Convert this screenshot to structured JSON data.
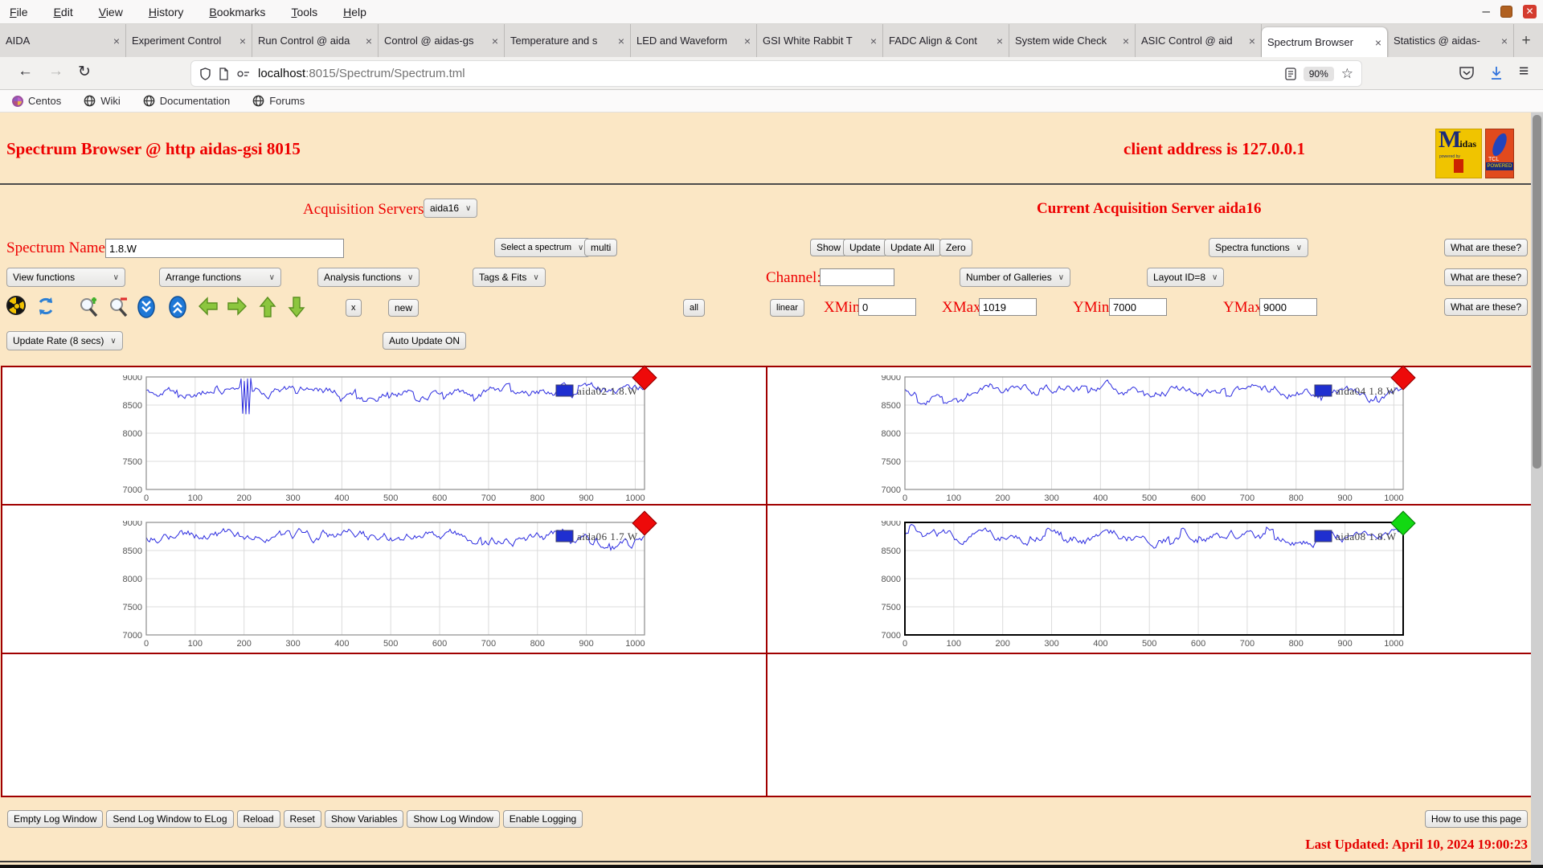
{
  "browser": {
    "menubar": {
      "items": [
        "File",
        "Edit",
        "View",
        "History",
        "Bookmarks",
        "Tools",
        "Help"
      ]
    },
    "tabs": [
      {
        "label": "AIDA",
        "active": false
      },
      {
        "label": "Experiment Control",
        "active": false
      },
      {
        "label": "Run Control @ aida",
        "active": false
      },
      {
        "label": "Control @ aidas-gs",
        "active": false
      },
      {
        "label": "Temperature and s",
        "active": false
      },
      {
        "label": "LED and Waveform",
        "active": false
      },
      {
        "label": "GSI White Rabbit T",
        "active": false
      },
      {
        "label": "FADC Align & Cont",
        "active": false
      },
      {
        "label": "System wide Check",
        "active": false
      },
      {
        "label": "ASIC Control @ aid",
        "active": false
      },
      {
        "label": "Spectrum Browser",
        "active": true
      },
      {
        "label": "Statistics @ aidas-",
        "active": false
      }
    ],
    "new_tab": "+",
    "nav": {
      "back": "←",
      "forward": "→",
      "reload": "↻",
      "url_host": "localhost",
      "url_rest": ":8015/Spectrum/Spectrum.tml",
      "zoom_badge": "90%",
      "star": "☆",
      "menu": "≡"
    },
    "bookmarks": [
      {
        "label": "Centos",
        "icon": "centos-icon"
      },
      {
        "label": "Wiki",
        "icon": "globe-icon"
      },
      {
        "label": "Documentation",
        "icon": "globe-icon"
      },
      {
        "label": "Forums",
        "icon": "globe-icon"
      }
    ]
  },
  "page": {
    "title": "Spectrum Browser @ http aidas-gsi 8015",
    "client_address": "client address is 127.0.0.1",
    "acquisition": {
      "label": "Acquisition Servers",
      "selected": "aida16",
      "current": "Current Acquisition Server aida16"
    },
    "spectrum_row": {
      "name_label": "Spectrum Name:",
      "name_value": "1.8.W",
      "select_spectrum": "Select a spectrum",
      "multi": "multi",
      "show": "Show",
      "update": "Update",
      "update_all": "Update All",
      "zero": "Zero",
      "spectra_functions": "Spectra functions",
      "what": "What are these?"
    },
    "functions_row": {
      "view": "View functions",
      "arrange": "Arrange functions",
      "analysis": "Analysis functions",
      "tags": "Tags & Fits",
      "channel_label": "Channel:",
      "channel_value": "",
      "galleries": "Number of Galleries",
      "layout": "Layout ID=8",
      "what": "What are these?"
    },
    "toolbar_row": {
      "icons": [
        "radioactive-icon",
        "refresh-icon",
        "zoom-in-icon",
        "zoom-out-icon",
        "collapse-vertical-icon",
        "expand-vertical-icon",
        "arrow-left-icon",
        "arrow-right-icon",
        "arrow-up-icon",
        "arrow-down-icon"
      ],
      "x": "x",
      "new": "new",
      "all": "all",
      "linear": "linear",
      "xmin_label": "XMin",
      "xmin_value": "0",
      "xmax_label": "XMax",
      "xmax_value": "1019",
      "ymin_label": "YMin",
      "ymin_value": "7000",
      "ymax_label": "YMax",
      "ymax_value": "9000",
      "what": "What are these?"
    },
    "update_row": {
      "rate": "Update Rate (8 secs)",
      "auto": "Auto Update ON"
    },
    "footer": {
      "buttons": [
        "Empty Log Window",
        "Send Log Window to ELog",
        "Reload",
        "Reset",
        "Show Variables",
        "Show Log Window",
        "Enable Logging"
      ],
      "help": "How to use this page",
      "last_updated": "Last Updated: April 10, 2024 19:00:23"
    }
  },
  "chart_data": {
    "type": "line",
    "xlim": [
      0,
      1019
    ],
    "ylim": [
      7000,
      9000
    ],
    "xticks": [
      0,
      100,
      200,
      300,
      400,
      500,
      600,
      700,
      800,
      900,
      1000
    ],
    "yticks": [
      9000,
      8500,
      8000,
      7500,
      7000
    ],
    "grid": true,
    "trace_color": "#2b2be0",
    "note": "Four live ADC baseline spectra, noisy traces fluctuating around ~8750 counts",
    "plots": [
      {
        "legend": "aida02 1.8.W",
        "marker": "red",
        "selected": false,
        "baseline": 8760,
        "noise_amp": 120,
        "seed": 11,
        "burst_at_x": 200
      },
      {
        "legend": "aida04 1.8.W",
        "marker": "red",
        "selected": false,
        "baseline": 8770,
        "noise_amp": 130,
        "seed": 22,
        "burst_at_x": null
      },
      {
        "legend": "aida06 1.7.W",
        "marker": "red",
        "selected": false,
        "baseline": 8730,
        "noise_amp": 140,
        "seed": 33,
        "burst_at_x": null
      },
      {
        "legend": "aida08 1.8.W",
        "marker": "green",
        "selected": true,
        "baseline": 8740,
        "noise_amp": 135,
        "seed": 44,
        "burst_at_x": null
      }
    ]
  }
}
